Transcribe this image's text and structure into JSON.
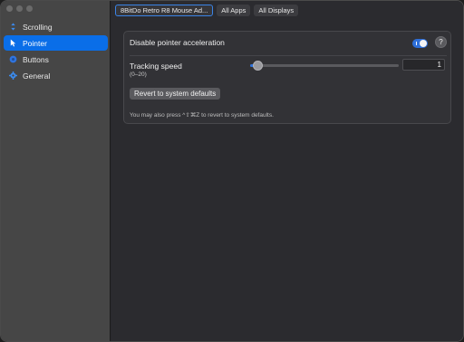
{
  "sidebar": {
    "items": [
      {
        "label": "Scrolling",
        "icon": "scroll-arrows-icon",
        "active": false
      },
      {
        "label": "Pointer",
        "icon": "pointer-arrow-icon",
        "active": true
      },
      {
        "label": "Buttons",
        "icon": "buttons-circle-icon",
        "active": false
      },
      {
        "label": "General",
        "icon": "gear-icon",
        "active": false
      }
    ]
  },
  "tabs": [
    {
      "label": "8BitDo Retro R8 Mouse Ad...",
      "selected": true
    },
    {
      "label": "All Apps",
      "selected": false
    },
    {
      "label": "All Displays",
      "selected": false
    }
  ],
  "settings": {
    "accel_label": "Disable pointer acceleration",
    "accel_enabled": true,
    "help_label": "?",
    "tracking_label": "Tracking speed",
    "tracking_range": "(0–20)",
    "tracking_value": "1",
    "tracking_fraction": 0.05,
    "revert_label": "Revert to system defaults",
    "hint": "You may also press ^⇧⌘Z to revert to system defaults."
  },
  "colors": {
    "accent": "#0a6ee8",
    "sidebar_bg": "#464646",
    "main_bg": "#2b2b2f"
  }
}
